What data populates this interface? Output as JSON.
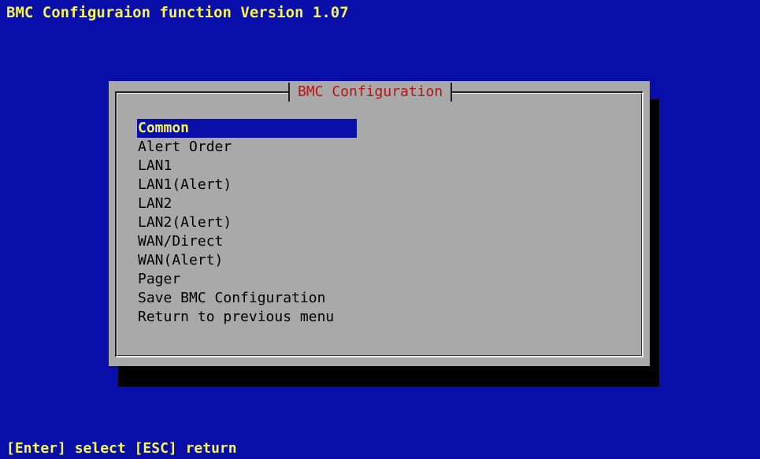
{
  "window": {
    "title": "BMC Configuraion function Version 1.07"
  },
  "dialog": {
    "title": "BMC Configuration",
    "selected_index": 0,
    "items": [
      {
        "label": "Common"
      },
      {
        "label": "Alert Order"
      },
      {
        "label": "LAN1"
      },
      {
        "label": "LAN1(Alert)"
      },
      {
        "label": "LAN2"
      },
      {
        "label": "LAN2(Alert)"
      },
      {
        "label": "WAN/Direct"
      },
      {
        "label": "WAN(Alert)"
      },
      {
        "label": "Pager"
      },
      {
        "label": "Save BMC Configuration"
      },
      {
        "label": "Return to previous menu"
      }
    ]
  },
  "status_bar": {
    "hint": "[Enter] select [ESC] return"
  },
  "colors": {
    "background": "#0a0ea8",
    "title_text": "#f5f553",
    "dialog_bg": "#a9a9a9",
    "dialog_title": "#b81414",
    "selection_bg": "#0a0ea8",
    "selection_text": "#f5f553",
    "shadow": "#000000"
  }
}
